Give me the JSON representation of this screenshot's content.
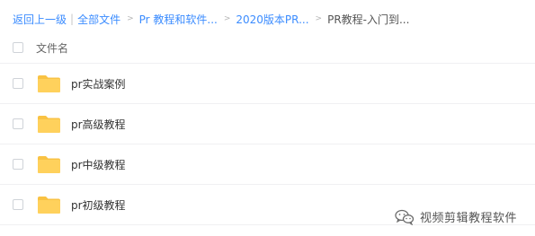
{
  "breadcrumb": {
    "back": "返回上一级",
    "separator": "|",
    "arrow": ">",
    "all_files": "全部文件",
    "crumb_1": "Pr 教程和软件...",
    "crumb_2": "2020版本PR...",
    "current": "PR教程-入门到..."
  },
  "table": {
    "header": "文件名"
  },
  "files": [
    {
      "name": "pr实战案例",
      "icon": "folder-icon"
    },
    {
      "name": "pr高级教程",
      "icon": "folder-icon"
    },
    {
      "name": "pr中级教程",
      "icon": "folder-icon"
    },
    {
      "name": "pr初级教程",
      "icon": "folder-icon"
    }
  ],
  "watermark": {
    "text": "视频剪辑教程软件",
    "icon": "wechat-icon"
  },
  "colors": {
    "link": "#3b8cff",
    "folder": "#ffd15c",
    "folder_tab": "#f9c243"
  }
}
